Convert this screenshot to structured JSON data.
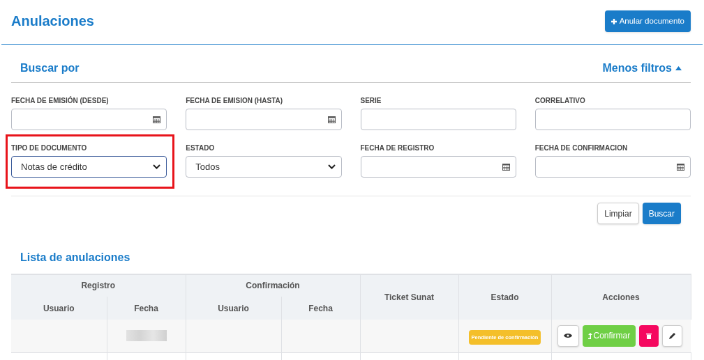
{
  "page_title": "Anulaciones",
  "primary_action": {
    "label": "Anular documento"
  },
  "search": {
    "title": "Buscar por",
    "toggle": "Menos filtros",
    "filters": [
      {
        "label": "FECHA DE EMISIÓN (DESDE)",
        "kind": "date",
        "highlighted": false
      },
      {
        "label": "FECHA DE EMISION (HASTA)",
        "kind": "date",
        "highlighted": false
      },
      {
        "label": "SERIE",
        "kind": "text",
        "highlighted": false
      },
      {
        "label": "CORRELATIVO",
        "kind": "text",
        "highlighted": false
      },
      {
        "label": "TIPO DE DOCUMENTO",
        "kind": "select",
        "value": "Notas de crédito",
        "highlighted": true
      },
      {
        "label": "ESTADO",
        "kind": "select",
        "value": "Todos",
        "highlighted": false
      },
      {
        "label": "FECHA DE REGISTRO",
        "kind": "date",
        "highlighted": false
      },
      {
        "label": "FECHA DE CONFIRMACION",
        "kind": "date",
        "highlighted": false
      }
    ],
    "buttons": [
      {
        "label": "Limpiar",
        "kind": "secondary"
      },
      {
        "label": "Buscar",
        "kind": "primary"
      }
    ]
  },
  "list": {
    "title": "Lista de anulaciones",
    "groups": [
      "Registro",
      "Confirmación"
    ],
    "columns": [
      "Usuario",
      "Fecha",
      "Usuario",
      "Fecha",
      "Ticket Sunat",
      "Estado",
      "Acciones"
    ],
    "rows": [
      {
        "status": "Pendiente de confirmación",
        "confirm": "Confirmar",
        "redacted_date": true
      }
    ]
  }
}
